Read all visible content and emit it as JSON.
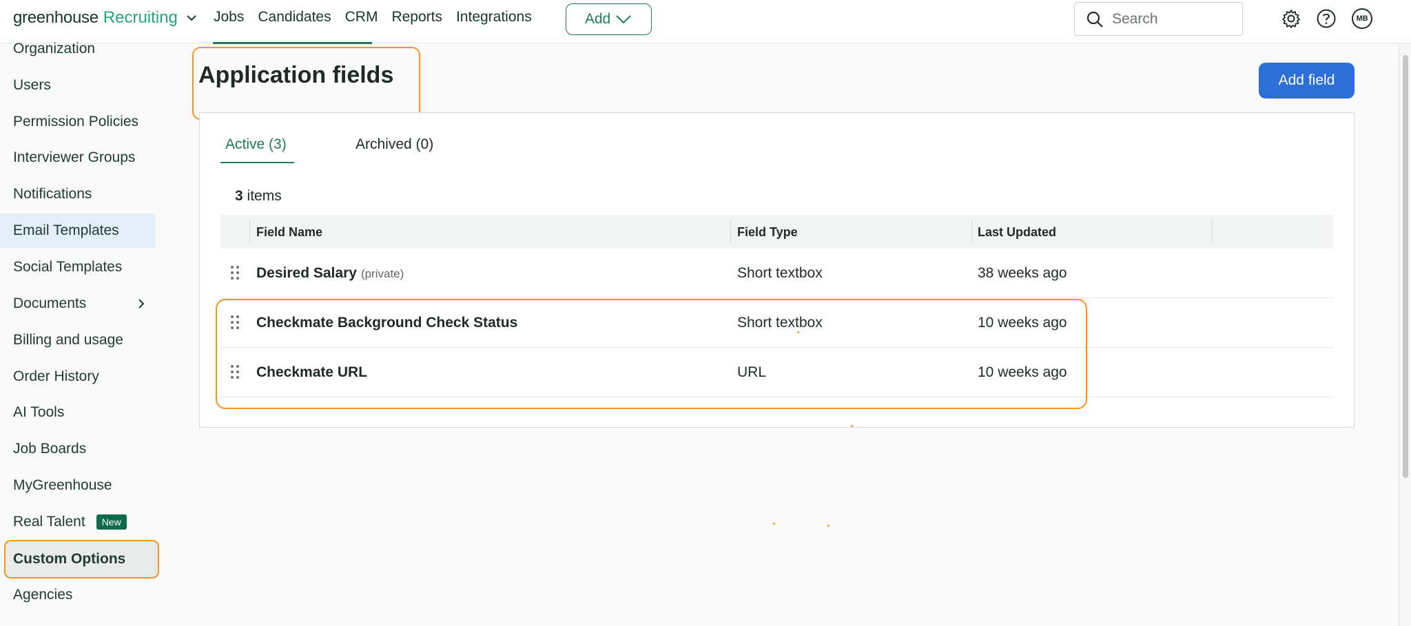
{
  "header": {
    "brand_main": "greenhouse",
    "brand_product": "Recruiting",
    "nav": [
      "Jobs",
      "Candidates",
      "CRM",
      "Reports",
      "Integrations"
    ],
    "add_label": "Add",
    "search_placeholder": "Search",
    "avatar_initials": "MB"
  },
  "sidebar": {
    "items": [
      {
        "label": "Organization"
      },
      {
        "label": "Users"
      },
      {
        "label": "Permission Policies"
      },
      {
        "label": "Interviewer Groups"
      },
      {
        "label": "Notifications"
      },
      {
        "label": "Email Templates"
      },
      {
        "label": "Social Templates"
      },
      {
        "label": "Documents"
      },
      {
        "label": "Billing and usage"
      },
      {
        "label": "Order History"
      },
      {
        "label": "AI Tools"
      },
      {
        "label": "Job Boards"
      },
      {
        "label": "MyGreenhouse"
      },
      {
        "label": "Real Talent",
        "badge": "New"
      },
      {
        "label": "Custom Options"
      },
      {
        "label": "Agencies"
      }
    ]
  },
  "main": {
    "title": "Application fields",
    "add_field_label": "Add field",
    "tabs": [
      {
        "label": "Active (3)",
        "active": true
      },
      {
        "label": "Archived (0)",
        "active": false
      }
    ],
    "item_count": "3",
    "item_count_suffix": " items",
    "columns": [
      "Field Name",
      "Field Type",
      "Last Updated"
    ],
    "rows": [
      {
        "name": "Desired Salary",
        "note": "(private)",
        "type": "Short textbox",
        "updated": "38 weeks ago"
      },
      {
        "name": "Checkmate Background Check Status",
        "note": "",
        "type": "Short textbox",
        "updated": "10 weeks ago"
      },
      {
        "name": "Checkmate URL",
        "note": "",
        "type": "URL",
        "updated": "10 weeks ago"
      }
    ]
  },
  "colors": {
    "brand_green": "#24a47f",
    "primary_blue": "#2c6fd6",
    "highlight_orange": "#f7931e"
  }
}
